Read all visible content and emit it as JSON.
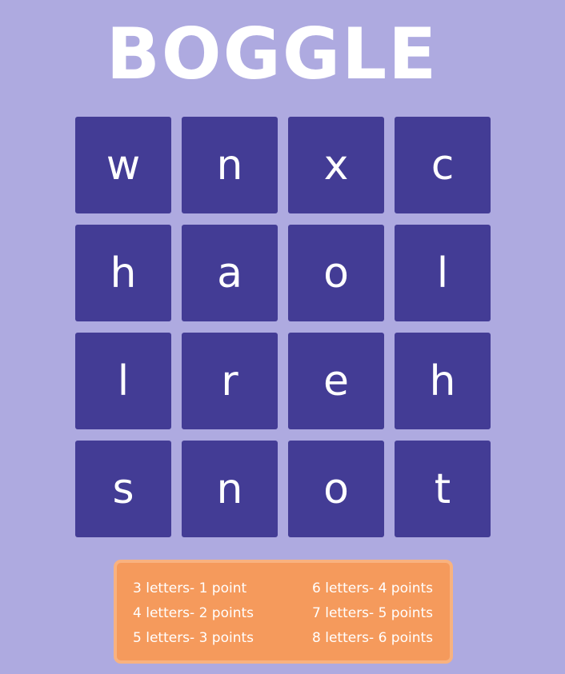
{
  "title": "BOGGLE",
  "board": {
    "tiles": [
      [
        "w",
        "n",
        "x",
        "c"
      ],
      [
        "h",
        "a",
        "o",
        "l"
      ],
      [
        "l",
        "r",
        "e",
        "h"
      ],
      [
        "s",
        "n",
        "o",
        "t"
      ]
    ]
  },
  "scoring": {
    "left": [
      "3 letters- 1 point",
      "4 letters- 2 points",
      "5 letters- 3 points"
    ],
    "right": [
      "6 letters- 4 points",
      "7 letters- 5 points",
      "8 letters- 6 points"
    ]
  },
  "colors": {
    "background": "#aeaae0",
    "tile": "#433c95",
    "scorecard": "#f59a5c",
    "text": "#ffffff"
  }
}
